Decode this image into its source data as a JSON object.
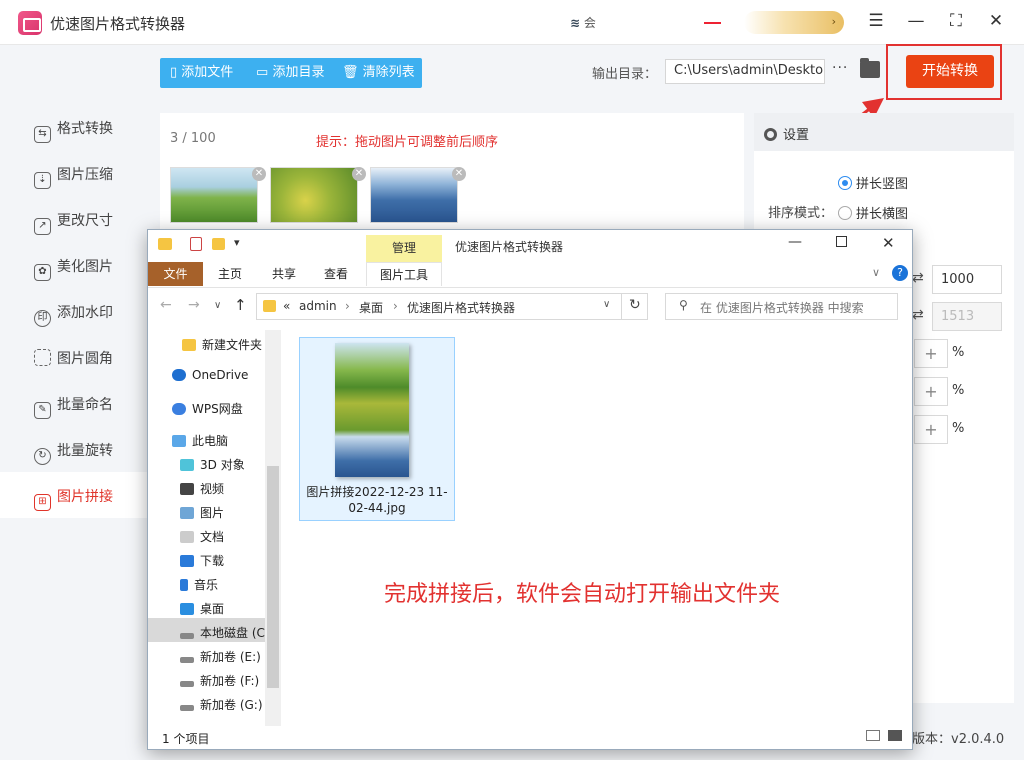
{
  "app": {
    "title": "优速图片格式转换器",
    "vip": "会",
    "version": "版本：v2.0.4.0"
  },
  "sidebar": {
    "items": [
      {
        "label": "格式转换",
        "icon": "convert-icon"
      },
      {
        "label": "图片压缩",
        "icon": "compress-icon"
      },
      {
        "label": "更改尺寸",
        "icon": "resize-icon"
      },
      {
        "label": "美化图片",
        "icon": "beautify-icon"
      },
      {
        "label": "添加水印",
        "icon": "watermark-icon"
      },
      {
        "label": "图片圆角",
        "icon": "rounded-corner-icon"
      },
      {
        "label": "批量命名",
        "icon": "rename-icon"
      },
      {
        "label": "批量旋转",
        "icon": "rotate-icon"
      },
      {
        "label": "图片拼接",
        "icon": "stitch-icon",
        "active": true
      }
    ]
  },
  "toolbar": {
    "add_file": "添加文件",
    "add_dir": "添加目录",
    "clear_list": "清除列表",
    "output_label": "输出目录：",
    "output_path": "C:\\Users\\admin\\Deskto",
    "start": "开始转换"
  },
  "list": {
    "count": "3 / 100",
    "hint": "提示：拖动图片可调整前后顺序"
  },
  "settings": {
    "title": "设置",
    "sort_label": "排序模式：",
    "opt_vertical": "拼长竖图",
    "opt_horizontal": "拼长横图",
    "width": "1000",
    "height": "1513",
    "pct": "%"
  },
  "explorer": {
    "title": "优速图片格式转换器",
    "manage": "管理",
    "tabs": [
      "文件",
      "主页",
      "共享",
      "查看",
      "图片工具"
    ],
    "breadcrumb": [
      "«",
      "admin",
      "桌面",
      "优速图片格式转换器"
    ],
    "search_placeholder": "在 优速图片格式转换器 中搜索",
    "nav": [
      "新建文件夹",
      "OneDrive",
      "WPS网盘",
      "此电脑",
      "3D 对象",
      "视频",
      "图片",
      "文档",
      "下载",
      "音乐",
      "桌面",
      "本地磁盘 (C",
      "新加卷 (E:)",
      "新加卷 (F:)",
      "新加卷 (G:)"
    ],
    "file_name": "图片拼接2022-12-23 11-02-44.jpg",
    "status": "1 个项目"
  },
  "annotation": "完成拼接后，软件会自动打开输出文件夹",
  "colors": {
    "accent": "#ea4313",
    "toolbar": "#3db0f0",
    "annotation": "#e23230"
  }
}
